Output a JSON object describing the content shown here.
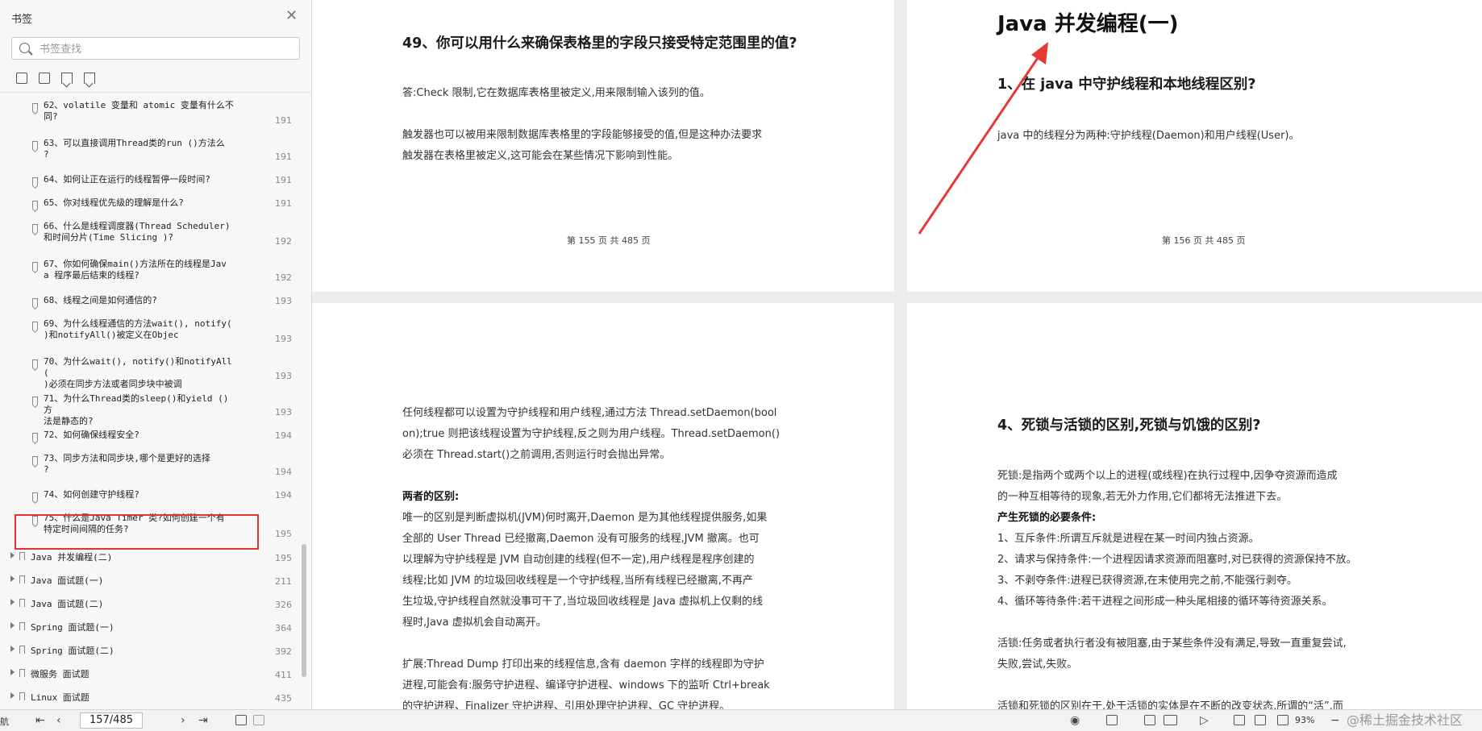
{
  "sidebar": {
    "title": "书签",
    "search_placeholder": "书签查找",
    "items": [
      {
        "label": "62、volatile 变量和 atomic 变量有什么不\n同?",
        "page": "191"
      },
      {
        "label": "63、可以直接调用Thread类的run ()方法么\n?",
        "page": "191"
      },
      {
        "label": "64、如何让正在运行的线程暂停一段时间?",
        "page": "191"
      },
      {
        "label": "65、你对线程优先级的理解是什么?",
        "page": "191"
      },
      {
        "label": "66、什么是线程调度器(Thread Scheduler)\n和时间分片(Time Slicing )?",
        "page": "192"
      },
      {
        "label": "67、你如何确保main()方法所在的线程是Jav\na 程序最后结束的线程?",
        "page": "192"
      },
      {
        "label": "68、线程之间是如何通信的?",
        "page": "193"
      },
      {
        "label": "69、为什么线程通信的方法wait(), notify(\n)和notifyAll()被定义在Objec",
        "page": "193"
      },
      {
        "label": "70、为什么wait(), notify()和notifyAll (\n)必须在同步方法或者同步块中被调",
        "page": "193"
      },
      {
        "label": "71、为什么Thread类的sleep()和yield ()方\n法是静态的?",
        "page": "193"
      },
      {
        "label": "72、如何确保线程安全?",
        "page": "194"
      },
      {
        "label": "73、同步方法和同步块,哪个是更好的选择\n?",
        "page": "194"
      },
      {
        "label": "74、如何创建守护线程?",
        "page": "194"
      },
      {
        "label": "75、什么是Java Timer 类?如何创建一个有\n特定时间间隔的任务?",
        "page": "195"
      }
    ],
    "chapters": [
      {
        "label": "Java 并发编程(二)",
        "page": "195"
      },
      {
        "label": "Java 面试题(一)",
        "page": "211"
      },
      {
        "label": "Java 面试题(二)",
        "page": "326"
      },
      {
        "label": "Spring 面试题(一)",
        "page": "364"
      },
      {
        "label": "Spring 面试题(二)",
        "page": "392"
      },
      {
        "label": "微服务 面试题",
        "page": "411"
      },
      {
        "label": "Linux 面试题",
        "page": "435"
      }
    ]
  },
  "page155": {
    "heading": "49、你可以用什么来确保表格里的字段只接受特定范围里的值?",
    "answer": "答:Check 限制,它在数据库表格里被定义,用来限制输入该列的值。",
    "trigger1": "触发器也可以被用来限制数据库表格里的字段能够接受的值,但是这种办法要求",
    "trigger2": "触发器在表格里被定义,这可能会在某些情况下影响到性能。",
    "footer": "第 155 页 共 485 页"
  },
  "page156": {
    "chapter_title": "Java 并发编程(一)",
    "heading": "1、在 java 中守护线程和本地线程区别?",
    "text": "java 中的线程分为两种:守护线程(Daemon)和用户线程(User)。",
    "footer": "第 156 页 共 485 页"
  },
  "page157": {
    "lines": [
      "任何线程都可以设置为守护线程和用户线程,通过方法 Thread.setDaemon(bool",
      "on);true 则把该线程设置为守护线程,反之则为用户线程。Thread.setDaemon()",
      "必须在 Thread.start()之前调用,否则运行时会抛出异常。",
      "",
      "两者的区别:",
      "唯一的区别是判断虚拟机(JVM)何时离开,Daemon 是为其他线程提供服务,如果",
      "全部的 User Thread 已经撤离,Daemon 没有可服务的线程,JVM 撤离。也可",
      "以理解为守护线程是 JVM 自动创建的线程(但不一定),用户线程是程序创建的",
      "线程;比如 JVM 的垃圾回收线程是一个守护线程,当所有线程已经撤离,不再产",
      "生垃圾,守护线程自然就没事可干了,当垃圾回收线程是 Java 虚拟机上仅剩的线",
      "程时,Java 虚拟机会自动离开。",
      "",
      "扩展:Thread Dump 打印出来的线程信息,含有 daemon 字样的线程即为守护",
      "进程,可能会有:服务守护进程、编译守护进程、windows 下的监听 Ctrl+break",
      "的守护进程、Finalizer 守护进程、引用处理守护进程、GC 守护进程。"
    ]
  },
  "page158": {
    "heading": "4、死锁与活锁的区别,死锁与饥饿的区别?",
    "lines": [
      "死锁:是指两个或两个以上的进程(或线程)在执行过程中,因争夺资源而造成",
      "的一种互相等待的现象,若无外力作用,它们都将无法推进下去。",
      "产生死锁的必要条件:",
      "1、互斥条件:所谓互斥就是进程在某一时间内独占资源。",
      "2、请求与保持条件:一个进程因请求资源而阻塞时,对已获得的资源保持不放。",
      "3、不剥夺条件:进程已获得资源,在末使用完之前,不能强行剥夺。",
      "4、循环等待条件:若干进程之间形成一种头尾相接的循环等待资源关系。",
      "",
      "活锁:任务或者执行者没有被阻塞,由于某些条件没有满足,导致一直重复尝试,",
      "失败,尝试,失败。",
      "",
      "活锁和死锁的区别在于,处于活锁的实体是在不断的改变状态,所谓的“活”,而"
    ]
  },
  "statusbar": {
    "nav_label": "航",
    "page_value": "157/485",
    "zoom": "93%",
    "watermark": "@稀土掘金技术社区"
  },
  "colors": {
    "highlight_box": "#e5322d",
    "arrow": "#e53935"
  }
}
